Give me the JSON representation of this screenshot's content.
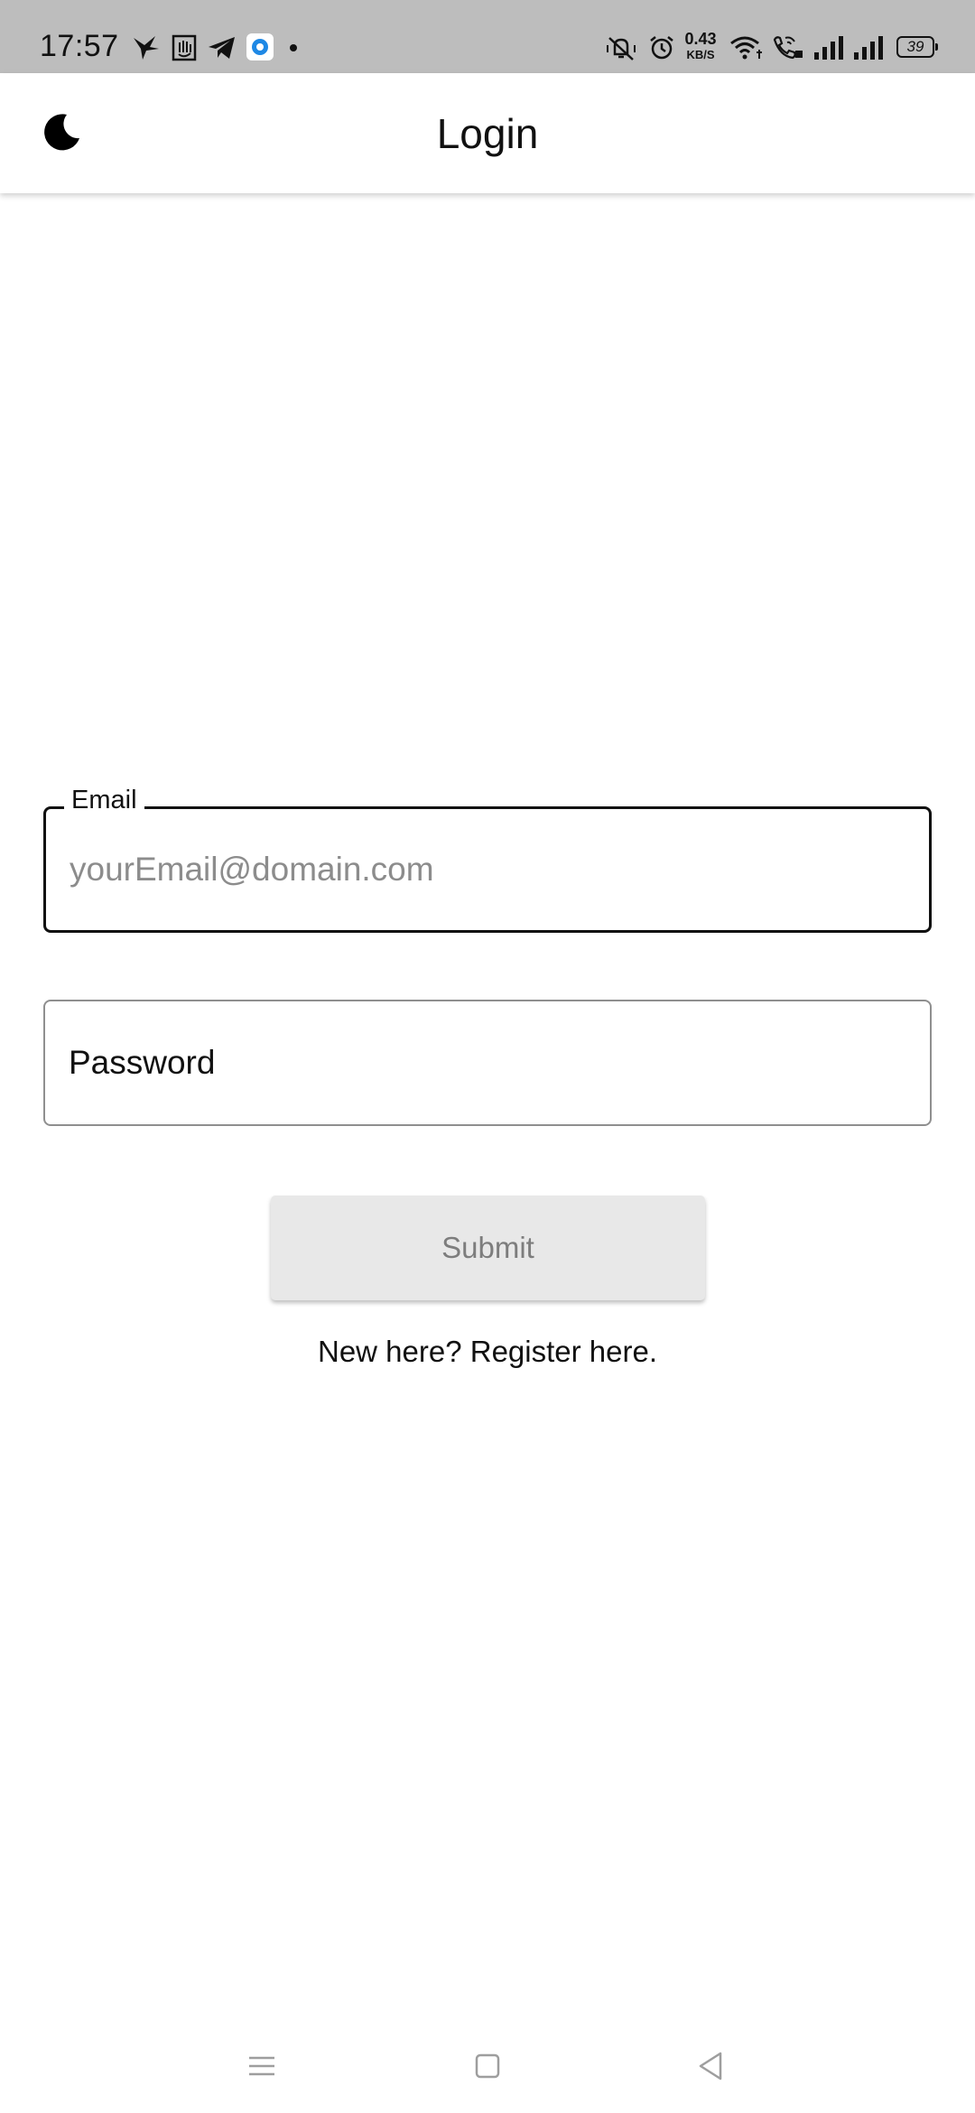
{
  "status_bar": {
    "time": "17:57",
    "notification_icons": [
      "bird-app-icon",
      "hand-app-icon",
      "telegram-icon",
      "blue-app-icon",
      "dot-icon"
    ],
    "net_speed_value": "0.43",
    "net_speed_unit": "KB/S",
    "battery_level": "39"
  },
  "app_bar": {
    "title": "Login",
    "theme_icon": "moon-icon"
  },
  "form": {
    "email": {
      "label": "Email",
      "placeholder": "yourEmail@domain.com",
      "value": ""
    },
    "password": {
      "placeholder": "Password",
      "value": ""
    },
    "submit_label": "Submit",
    "register_text": "New here? Register here."
  },
  "nav_bar": {
    "icons": [
      "menu-icon",
      "home-square-icon",
      "back-triangle-icon"
    ]
  }
}
